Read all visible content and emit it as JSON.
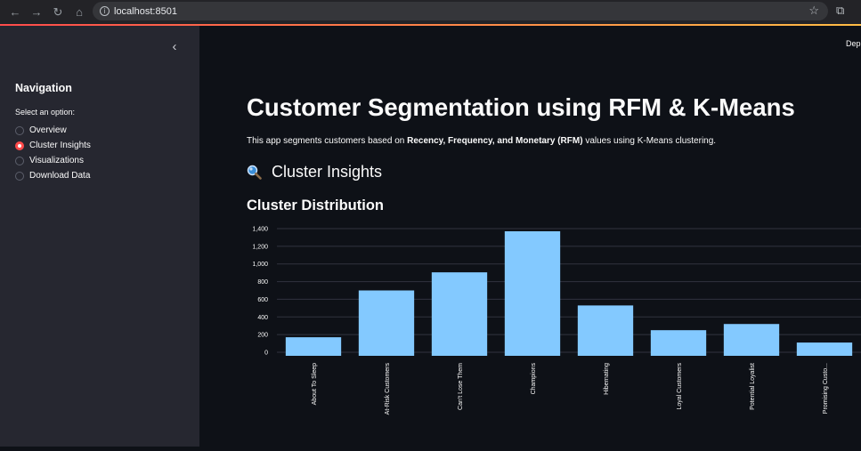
{
  "browser": {
    "url": "localhost:8501"
  },
  "sidebar": {
    "title": "Navigation",
    "subtitle": "Select an option:",
    "options": [
      "Overview",
      "Cluster Insights",
      "Visualizations",
      "Download Data"
    ],
    "selected": "Cluster Insights"
  },
  "main": {
    "deploy_label": "Depl",
    "title": "Customer Segmentation using RFM & K-Means",
    "desc_prefix": "This app segments customers based on ",
    "desc_bold": "Recency, Frequency, and Monetary (RFM)",
    "desc_suffix": " values using K-Means clustering.",
    "section_title": "Cluster Insights",
    "section_icon": "magnifier-icon",
    "chart_title": "Cluster Distribution"
  },
  "colors": {
    "accent": "#ff4b4b",
    "bar": "#83c9ff",
    "background": "#0e1117",
    "sidebar": "#262730"
  },
  "chart_data": {
    "type": "bar",
    "categories": [
      "About To Sleep",
      "At-Risk Customers",
      "Can't Lose Them",
      "Champions",
      "Hibernating",
      "Loyal Customers",
      "Potential Loyalist",
      "Promising Custo..."
    ],
    "values": [
      170,
      700,
      905,
      1370,
      530,
      250,
      320,
      110
    ],
    "yticks": [
      0,
      200,
      400,
      600,
      800,
      1000,
      1200,
      1400
    ],
    "ytick_labels": [
      "0",
      "200",
      "400",
      "600",
      "800",
      "1,000",
      "1,200",
      "1,400"
    ],
    "ylim": [
      0,
      1400
    ],
    "grid": true
  }
}
